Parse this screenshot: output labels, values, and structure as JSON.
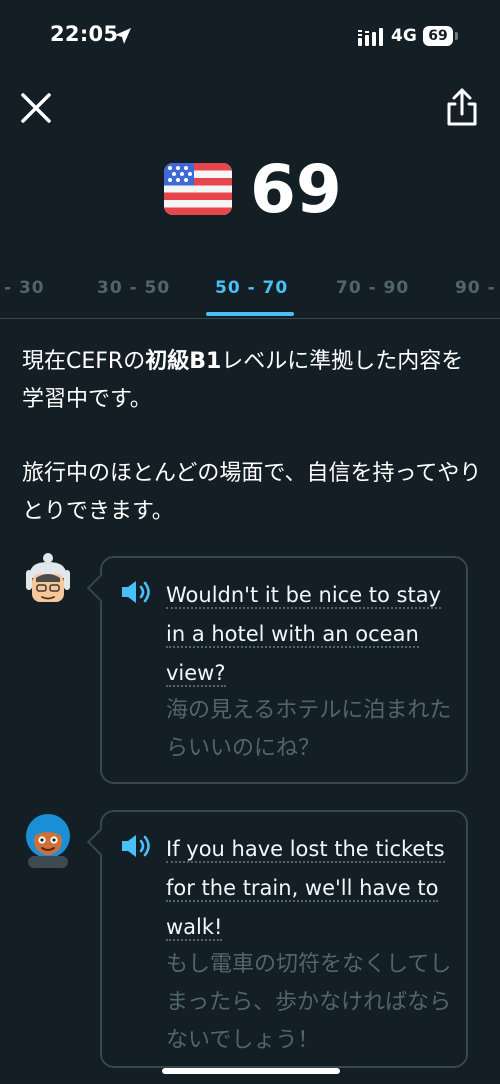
{
  "status_bar": {
    "time": "22:05",
    "network": "4G",
    "battery": "69"
  },
  "header": {
    "close_icon": "close-icon",
    "share_icon": "share-icon"
  },
  "score": {
    "flag": "us-flag",
    "value": "69"
  },
  "tabs": [
    {
      "label": "- 30"
    },
    {
      "label": "30 - 50"
    },
    {
      "label": "50 - 70",
      "active": true
    },
    {
      "label": "70 - 90"
    },
    {
      "label": "90 -"
    }
  ],
  "description": {
    "line1_pre": "現在CEFRの",
    "line1_bold": "初級B1",
    "line1_post": "レベルに準拠した内容を学習中です。",
    "line2": "旅行中のほとんどの場面で、自信を持ってやりとりできます。"
  },
  "examples": [
    {
      "avatar": "character-avatar-old-man",
      "english": "Wouldn't it be nice to stay in a hotel with an ocean view?",
      "japanese": "海の見えるホテルに泊まれたらいいのにね？"
    },
    {
      "avatar": "character-avatar-blue-hair",
      "english": "If you have lost the tickets for the train, we'll have to walk!",
      "japanese": "もし電車の切符をなくしてしまったら、歩かなければならないでしょう！"
    }
  ],
  "colors": {
    "background": "#131f24",
    "accent": "#49c0f8",
    "muted": "#52656d",
    "border": "#37464f"
  }
}
